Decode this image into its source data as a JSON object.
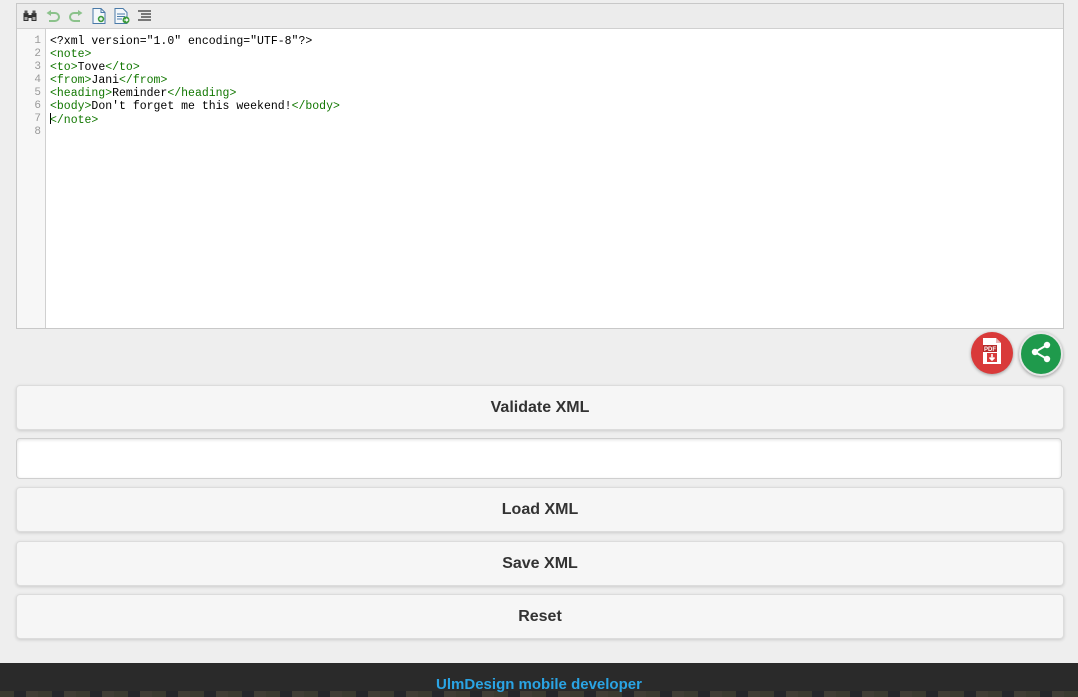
{
  "toolbar": {
    "icons": [
      "search-icon",
      "undo-icon",
      "redo-icon",
      "new-document-icon",
      "open-document-icon",
      "format-icon"
    ]
  },
  "editor": {
    "line_numbers": [
      "1",
      "2",
      "3",
      "4",
      "5",
      "6",
      "7",
      "8"
    ],
    "lines": [
      "<?xml version=\"1.0\" encoding=\"UTF-8\"?>",
      "<note>",
      "<to>Tove</to>",
      "<from>Jani</from>",
      "<heading>Reminder</heading>",
      "<body>Don't forget me this weekend!</body>",
      "</note>",
      ""
    ],
    "cursor_line": 7
  },
  "fabs": {
    "pdf": {
      "icon": "pdf-download-icon",
      "label": "PDF",
      "color": "#d93a3a"
    },
    "share": {
      "icon": "share-icon",
      "color": "#1f9a4c"
    }
  },
  "buttons": {
    "validate": "Validate XML",
    "load": "Load XML",
    "save": "Save XML",
    "reset": "Reset"
  },
  "result": "",
  "footer": {
    "text": "UlmDesign mobile developer",
    "color": "#2aa4e4"
  }
}
